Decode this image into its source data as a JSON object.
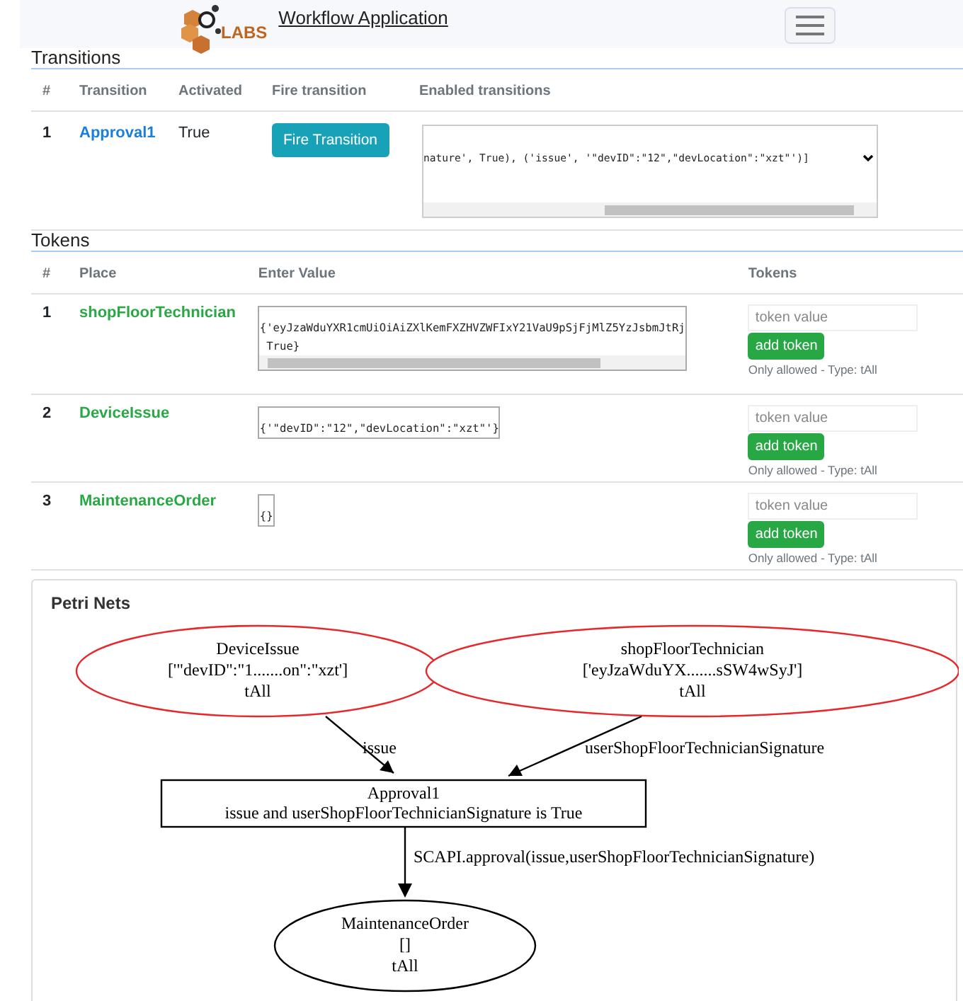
{
  "navbar": {
    "brand_text": "LABS",
    "title": "Workflow Application"
  },
  "transitions": {
    "title": "Transitions",
    "columns": [
      "#",
      "Transition",
      "Activated",
      "Fire transition",
      "Enabled transitions"
    ],
    "rows": [
      {
        "index": "1",
        "name": "Approval1",
        "activated": "True",
        "button": "Fire Transition",
        "enabled": "nature', True), ('issue', '\"devID\":\"12\",\"devLocation\":\"xzt\"')]"
      }
    ]
  },
  "tokens": {
    "title": "Tokens",
    "columns": [
      "#",
      "Place",
      "Enter Value",
      "Tokens"
    ],
    "rows": [
      {
        "index": "1",
        "place": "shopFloorTechnician",
        "value_lines": [
          "{'eyJzaWduYXR1cmUiOiAiZXlKemFXZHVZWFIxY21VaU9pSjFjMlZ5YzJsbmJtRj",
          " True}"
        ],
        "scrollable": true,
        "placeholder": "token value",
        "button": "add token",
        "hint": "Only allowed - Type: tAll"
      },
      {
        "index": "2",
        "place": "DeviceIssue",
        "value_lines": [
          "{'\"devID\":\"12\",\"devLocation\":\"xzt\"'}"
        ],
        "scrollable": false,
        "placeholder": "token value",
        "button": "add token",
        "hint": "Only allowed - Type: tAll"
      },
      {
        "index": "3",
        "place": "MaintenanceOrder",
        "value_lines": [
          "{}"
        ],
        "scrollable": false,
        "placeholder": "token value",
        "button": "add token",
        "hint": "Only allowed - Type: tAll"
      }
    ]
  },
  "petri": {
    "title": "Petri Nets",
    "places": [
      {
        "lines": [
          "DeviceIssue",
          "['\"devID\":\"1.......on\":\"xzt']",
          "tAll"
        ],
        "color": "#e8272a"
      },
      {
        "lines": [
          "shopFloorTechnician",
          "['eyJzaWduYX.......sSW4wSyJ']",
          "tAll"
        ],
        "color": "#e8272a"
      },
      {
        "lines": [
          "MaintenanceOrder",
          "[]",
          "tAll"
        ],
        "color": "#000000"
      }
    ],
    "transitions": [
      {
        "lines": [
          "Approval1",
          "issue and userShopFloorTechnicianSignature is True"
        ]
      }
    ],
    "arcs": [
      {
        "label": "issue"
      },
      {
        "label": "userShopFloorTechnicianSignature"
      },
      {
        "label": "SCAPI.approval(issue,userShopFloorTechnicianSignature)"
      }
    ]
  }
}
